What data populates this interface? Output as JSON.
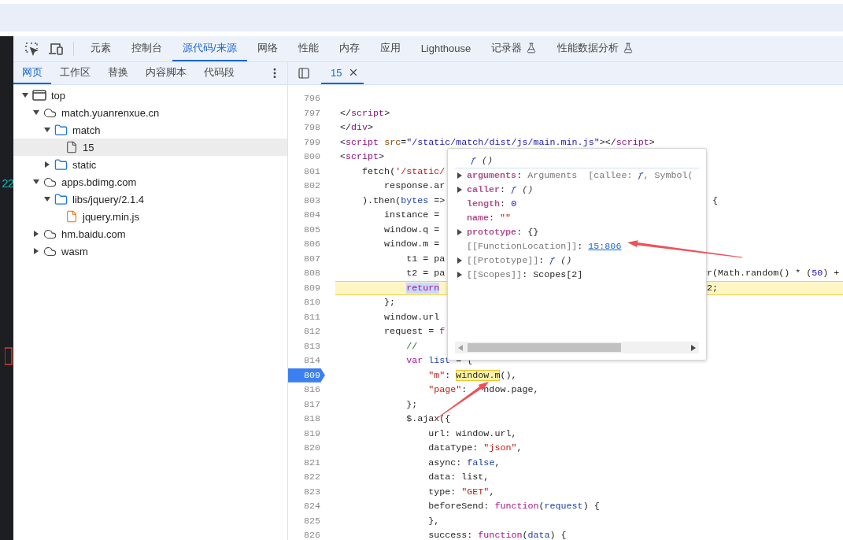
{
  "page_preview": {
    "text": "22"
  },
  "main_tabs": [
    {
      "label": "元素",
      "selected": false,
      "experimental": false
    },
    {
      "label": "控制台",
      "selected": false,
      "experimental": false
    },
    {
      "label": "源代码/来源",
      "selected": true,
      "experimental": false
    },
    {
      "label": "网络",
      "selected": false,
      "experimental": false
    },
    {
      "label": "性能",
      "selected": false,
      "experimental": false
    },
    {
      "label": "内存",
      "selected": false,
      "experimental": false
    },
    {
      "label": "应用",
      "selected": false,
      "experimental": false
    },
    {
      "label": "Lighthouse",
      "selected": false,
      "experimental": false
    },
    {
      "label": "记录器",
      "selected": false,
      "experimental": true
    },
    {
      "label": "性能数据分析",
      "selected": false,
      "experimental": true
    }
  ],
  "navigator_tabs": [
    {
      "label": "网页",
      "selected": true
    },
    {
      "label": "工作区",
      "selected": false
    },
    {
      "label": "替换",
      "selected": false
    },
    {
      "label": "内容脚本",
      "selected": false
    },
    {
      "label": "代码段",
      "selected": false
    }
  ],
  "tree": [
    {
      "label": "top",
      "kind": "frame",
      "expanded": true,
      "selected": false,
      "children": [
        {
          "label": "match.yuanrenxue.cn",
          "kind": "domain",
          "expanded": true,
          "selected": false,
          "children": [
            {
              "label": "match",
              "kind": "folder",
              "expanded": true,
              "selected": false,
              "children": [
                {
                  "label": "15",
                  "kind": "file",
                  "selected": true
                }
              ]
            },
            {
              "label": "static",
              "kind": "folder",
              "expanded": false,
              "selected": false
            }
          ]
        },
        {
          "label": "apps.bdimg.com",
          "kind": "domain",
          "expanded": true,
          "selected": false,
          "children": [
            {
              "label": "libs/jquery/2.1.4",
              "kind": "folder",
              "expanded": true,
              "selected": false,
              "children": [
                {
                  "label": "jquery.min.js",
                  "kind": "script",
                  "selected": false
                }
              ]
            }
          ]
        },
        {
          "label": "hm.baidu.com",
          "kind": "domain",
          "expanded": false,
          "selected": false
        },
        {
          "label": "wasm",
          "kind": "domain",
          "expanded": false,
          "selected": false
        }
      ]
    }
  ],
  "editor_tabs": [
    {
      "label": "15",
      "selected": true
    }
  ],
  "code_lines": [
    {
      "number": "796",
      "paused": false,
      "breakpoint": false
    },
    {
      "number": "797",
      "paused": false,
      "breakpoint": false,
      "segments": [
        {
          "text": "</",
          "kind": "plain"
        },
        {
          "text": "script",
          "kind": "tag"
        },
        {
          "text": ">",
          "kind": "plain"
        }
      ]
    },
    {
      "number": "798",
      "paused": false,
      "breakpoint": false,
      "segments": [
        {
          "text": "</",
          "kind": "plain"
        },
        {
          "text": "div",
          "kind": "tag"
        },
        {
          "text": ">",
          "kind": "plain"
        }
      ]
    },
    {
      "number": "799",
      "paused": false,
      "breakpoint": false,
      "segments": [
        {
          "text": "<",
          "kind": "plain"
        },
        {
          "text": "script",
          "kind": "tag"
        },
        {
          "text": " src",
          "kind": "attr"
        },
        {
          "text": "=",
          "kind": "plain"
        },
        {
          "text": "\"/static/match/dist/js/main.min.js\"",
          "kind": "attrval"
        },
        {
          "text": "></",
          "kind": "plain"
        },
        {
          "text": "script",
          "kind": "tag"
        },
        {
          "text": ">",
          "kind": "plain"
        }
      ]
    },
    {
      "number": "800",
      "paused": false,
      "breakpoint": false,
      "segments": [
        {
          "text": "<",
          "kind": "plain"
        },
        {
          "text": "script",
          "kind": "tag"
        },
        {
          "text": ">",
          "kind": "plain"
        }
      ]
    },
    {
      "number": "801",
      "paused": false,
      "breakpoint": false,
      "segments": [
        {
          "text": "    fetch(",
          "kind": "plain"
        },
        {
          "text": "'/static/",
          "kind": "string"
        }
      ]
    },
    {
      "number": "802",
      "paused": false,
      "breakpoint": false,
      "segments": [
        {
          "text": "        response.ar",
          "kind": "plain"
        }
      ]
    },
    {
      "number": "803",
      "paused": false,
      "breakpoint": false,
      "segments": [
        {
          "text": "    ).then(",
          "kind": "plain"
        },
        {
          "text": "bytes",
          "kind": "var"
        },
        {
          "text": " =>",
          "kind": "plain"
        }
      ],
      "right": [
        {
          "text": " {",
          "kind": "plain"
        }
      ]
    },
    {
      "number": "804",
      "paused": false,
      "breakpoint": false,
      "segments": [
        {
          "text": "        instance =",
          "kind": "plain"
        }
      ]
    },
    {
      "number": "805",
      "paused": false,
      "breakpoint": false,
      "segments": [
        {
          "text": "        window.q =",
          "kind": "plain"
        }
      ]
    },
    {
      "number": "806",
      "paused": false,
      "breakpoint": false,
      "segments": [
        {
          "text": "        window.m =",
          "kind": "plain"
        }
      ]
    },
    {
      "number": "807",
      "paused": false,
      "breakpoint": false,
      "segments": [
        {
          "text": "            t1 = pa",
          "kind": "plain"
        }
      ]
    },
    {
      "number": "808",
      "paused": false,
      "breakpoint": false,
      "segments": [
        {
          "text": "            t2 = pa",
          "kind": "plain"
        }
      ],
      "right": [
        {
          "text": "r(Math.random() * (",
          "kind": "plain"
        },
        {
          "text": "50",
          "kind": "number"
        },
        {
          "text": ") +",
          "kind": "plain"
        }
      ]
    },
    {
      "number": "809",
      "paused": true,
      "breakpoint": false,
      "segments": [
        {
          "text": "            return",
          "kind": "selected-keyword"
        }
      ],
      "right": [
        {
          "text": "2;",
          "kind": "plain"
        }
      ]
    },
    {
      "number": "810",
      "paused": false,
      "breakpoint": false,
      "segments": [
        {
          "text": "        };",
          "kind": "plain"
        }
      ]
    },
    {
      "number": "811",
      "paused": false,
      "breakpoint": false,
      "segments": [
        {
          "text": "        window.url",
          "kind": "plain"
        }
      ]
    },
    {
      "number": "812",
      "paused": false,
      "breakpoint": false,
      "segments": [
        {
          "text": "        request =",
          "kind": "plain"
        },
        {
          "text": " f",
          "kind": "keyword"
        }
      ]
    },
    {
      "number": "813",
      "paused": false,
      "breakpoint": false,
      "segments": [
        {
          "text": "            //",
          "kind": "comment"
        }
      ]
    },
    {
      "number": "814",
      "paused": false,
      "breakpoint": false,
      "segments": [
        {
          "text": "            var",
          "kind": "keyword"
        },
        {
          "text": " list",
          "kind": "var"
        },
        {
          "text": " = {",
          "kind": "plain"
        }
      ]
    },
    {
      "number": "809",
      "paused": false,
      "breakpoint": true,
      "segments": [
        {
          "text": "                \"m\"",
          "kind": "string"
        },
        {
          "text": ": ",
          "kind": "plain"
        },
        {
          "text": "window.m",
          "kind": "match"
        },
        {
          "text": "(),",
          "kind": "plain"
        }
      ]
    },
    {
      "number": "816",
      "paused": false,
      "breakpoint": false,
      "segments": [
        {
          "text": "                \"page\"",
          "kind": "string"
        },
        {
          "text": ":",
          "kind": "plain"
        },
        {
          "text": "ndow.page,",
          "kind": "resume"
        }
      ]
    },
    {
      "number": "817",
      "paused": false,
      "breakpoint": false,
      "segments": [
        {
          "text": "            };",
          "kind": "plain"
        }
      ]
    },
    {
      "number": "818",
      "paused": false,
      "breakpoint": false,
      "segments": [
        {
          "text": "            $.ajax({",
          "kind": "plain"
        }
      ]
    },
    {
      "number": "819",
      "paused": false,
      "breakpoint": false,
      "segments": [
        {
          "text": "                url: window.url,",
          "kind": "plain"
        }
      ]
    },
    {
      "number": "820",
      "paused": false,
      "breakpoint": false,
      "segments": [
        {
          "text": "                dataType: ",
          "kind": "plain"
        },
        {
          "text": "\"json\"",
          "kind": "string"
        },
        {
          "text": ",",
          "kind": "plain"
        }
      ]
    },
    {
      "number": "821",
      "paused": false,
      "breakpoint": false,
      "segments": [
        {
          "text": "                async: ",
          "kind": "plain"
        },
        {
          "text": "false",
          "kind": "var"
        },
        {
          "text": ",",
          "kind": "plain"
        }
      ]
    },
    {
      "number": "822",
      "paused": false,
      "breakpoint": false,
      "segments": [
        {
          "text": "                data: list,",
          "kind": "plain"
        }
      ]
    },
    {
      "number": "823",
      "paused": false,
      "breakpoint": false,
      "segments": [
        {
          "text": "                type: ",
          "kind": "plain"
        },
        {
          "text": "\"GET\"",
          "kind": "string"
        },
        {
          "text": ",",
          "kind": "plain"
        }
      ]
    },
    {
      "number": "824",
      "paused": false,
      "breakpoint": false,
      "segments": [
        {
          "text": "                beforeSend: ",
          "kind": "plain"
        },
        {
          "text": "function",
          "kind": "keyword"
        },
        {
          "text": "(",
          "kind": "plain"
        },
        {
          "text": "request",
          "kind": "var"
        },
        {
          "text": ") {",
          "kind": "plain"
        }
      ]
    },
    {
      "number": "825",
      "paused": false,
      "breakpoint": false,
      "segments": [
        {
          "text": "                },",
          "kind": "plain"
        }
      ]
    },
    {
      "number": "826",
      "paused": false,
      "breakpoint": false,
      "segments": [
        {
          "text": "                success: ",
          "kind": "plain"
        },
        {
          "text": "function",
          "kind": "keyword"
        },
        {
          "text": "(",
          "kind": "plain"
        },
        {
          "text": "data",
          "kind": "var"
        },
        {
          "text": ") {",
          "kind": "plain"
        }
      ]
    }
  ],
  "preview": {
    "header": [
      {
        "text": "ƒ",
        "kind": "func"
      },
      {
        "text": " ()",
        "kind": "paren"
      }
    ],
    "properties": [
      {
        "key": "arguments",
        "internal": false,
        "expandable": true,
        "value": [
          {
            "text": ": ",
            "kind": "plain"
          },
          {
            "text": "Arguments  [callee: ",
            "kind": "gray"
          },
          {
            "text": "ƒ",
            "kind": "func"
          },
          {
            "text": ", Symbol(",
            "kind": "gray"
          }
        ]
      },
      {
        "key": "caller",
        "internal": false,
        "expandable": true,
        "value": [
          {
            "text": ": ",
            "kind": "plain"
          },
          {
            "text": "ƒ",
            "kind": "func"
          },
          {
            "text": " ()",
            "kind": "paren"
          }
        ]
      },
      {
        "key": "length",
        "internal": false,
        "expandable": false,
        "value": [
          {
            "text": ": ",
            "kind": "plain"
          },
          {
            "text": "0",
            "kind": "number"
          }
        ]
      },
      {
        "key": "name",
        "internal": false,
        "expandable": false,
        "value": [
          {
            "text": ": ",
            "kind": "plain"
          },
          {
            "text": "\"\"",
            "kind": "string"
          }
        ]
      },
      {
        "key": "prototype",
        "internal": false,
        "expandable": true,
        "value": [
          {
            "text": ": ",
            "kind": "plain"
          },
          {
            "text": "{}",
            "kind": "plain"
          }
        ]
      },
      {
        "key": "[[FunctionLocation]]",
        "internal": true,
        "expandable": false,
        "value": [
          {
            "text": ": ",
            "kind": "plain"
          },
          {
            "text": "15:806",
            "kind": "link"
          }
        ]
      },
      {
        "key": "[[Prototype]]",
        "internal": true,
        "expandable": true,
        "value": [
          {
            "text": ": ",
            "kind": "plain"
          },
          {
            "text": "ƒ",
            "kind": "func"
          },
          {
            "text": " ()",
            "kind": "paren"
          }
        ]
      },
      {
        "key": "[[Scopes]]",
        "internal": true,
        "expandable": true,
        "value": [
          {
            "text": ": ",
            "kind": "plain"
          },
          {
            "text": "Scopes[2]",
            "kind": "plain"
          }
        ]
      }
    ]
  }
}
